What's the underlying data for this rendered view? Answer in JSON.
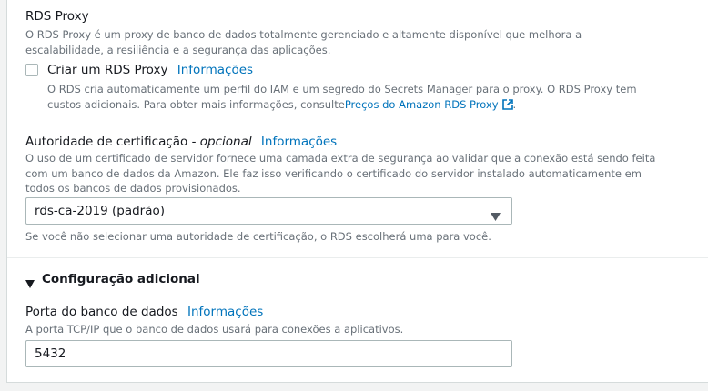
{
  "rds_proxy": {
    "title": "RDS Proxy",
    "description": "O RDS Proxy é um proxy de banco de dados totalmente gerenciado e altamente disponível que melhora a escalabilidade, a resiliência e a segurança das aplicações.",
    "checkbox_label": "Criar um RDS Proxy",
    "info_link": "Informações",
    "checkbox_checked": false,
    "note_text": "O RDS cria automaticamente um perfil do IAM e um segredo do Secrets Manager para o proxy. O RDS Proxy tem custos adicionais. Para obter mais informações, consulte",
    "pricing_link": "Preços do Amazon RDS Proxy",
    "note_end": "."
  },
  "certificate_authority": {
    "label": "Autoridade de certificação -",
    "optional": "opcional",
    "info_link": "Informações",
    "description": "O uso de um certificado de servidor fornece uma camada extra de segurança ao validar que a conexão está sendo feita com um banco de dados da Amazon. Ele faz isso verificando o certificado do servidor instalado automaticamente em todos os bancos de dados provisionados.",
    "selected_value": "rds-ca-2019 (padrão)",
    "hint": "Se você não selecionar uma autoridade de certificação, o RDS escolherá uma para você."
  },
  "additional_config": {
    "title": "Configuração adicional",
    "expanded": true
  },
  "database_port": {
    "label": "Porta do banco de dados",
    "info_link": "Informações",
    "description": "A porta TCP/IP que o banco de dados usará para conexões a aplicativos.",
    "value": "5432"
  },
  "colors": {
    "link": "#0073bb",
    "text": "#16191f",
    "secondary_text": "#687078",
    "border": "#aab7b8",
    "background": "#f2f3f3"
  }
}
